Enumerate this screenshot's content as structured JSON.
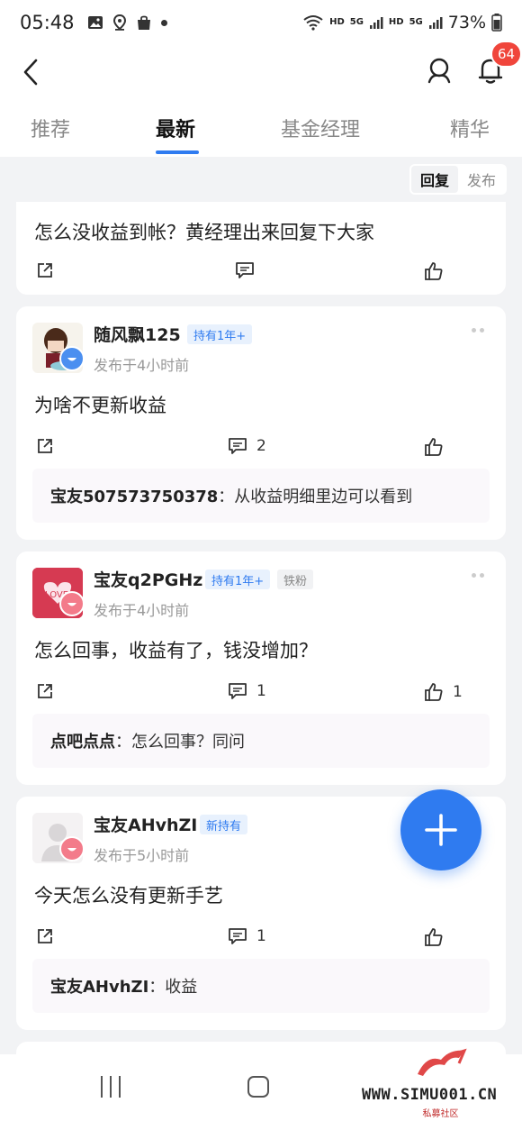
{
  "status_bar": {
    "time": "05:48",
    "hd1": "HD",
    "net1": "5G",
    "hd2": "HD",
    "net2": "5G",
    "battery": "73%"
  },
  "header": {
    "notification_count": "64"
  },
  "tabs": [
    {
      "label": "推荐"
    },
    {
      "label": "最新"
    },
    {
      "label": "基金经理"
    },
    {
      "label": "精华"
    }
  ],
  "sort": {
    "reply": "回复",
    "publish": "发布"
  },
  "posts": [
    {
      "content": "怎么没收益到帐？黄经理出来回复下大家"
    },
    {
      "username": "随风飘125",
      "tag": "持有1年+",
      "time": "发布于4小时前",
      "content": "为啥不更新收益",
      "comments": "2",
      "reply_user": "宝友507573750378",
      "reply_text": "：从收益明细里边可以看到"
    },
    {
      "username": "宝友q2PGHz",
      "tag": "持有1年+",
      "tag2": "铁粉",
      "time": "发布于4小时前",
      "content": "怎么回事，收益有了，钱没增加？",
      "comments": "1",
      "likes": "1",
      "reply_user": "点吧点点",
      "reply_text": "：怎么回事？同问"
    },
    {
      "username": "宝友AHvhZI",
      "tag": "新持有",
      "time": "发布于5小时前",
      "content": "今天怎么没有更新手艺",
      "comments": "1",
      "reply_user": "宝友AHvhZI",
      "reply_text": "：收益"
    }
  ],
  "watermark": {
    "text": "WWW.SIMU001.CN",
    "sub": "私募社区"
  },
  "colors": {
    "accent": "#2f7bf0",
    "badge": "#f0453b"
  }
}
